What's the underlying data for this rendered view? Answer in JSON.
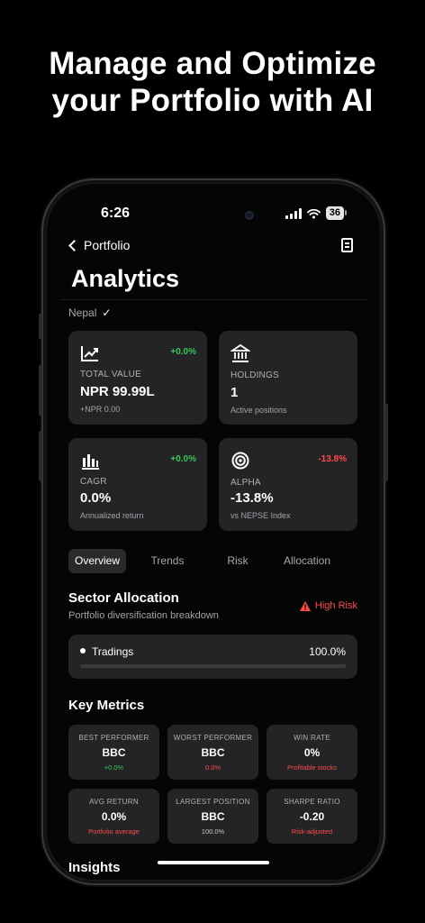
{
  "promo": {
    "line1": "Manage and Optimize",
    "line2": "your Portfolio with AI"
  },
  "status": {
    "time": "6:26",
    "battery": "36"
  },
  "nav": {
    "back_label": "Portfolio"
  },
  "page": {
    "title": "Analytics",
    "region": "Nepal",
    "region_check": "✓"
  },
  "cards": [
    {
      "label": "TOTAL VALUE",
      "value": "NPR 99.99L",
      "sub": "+NPR 0.00",
      "change": "+0.0%",
      "icon": "trend-chart-icon"
    },
    {
      "label": "HOLDINGS",
      "value": "1",
      "sub": "Active positions",
      "change": "",
      "icon": "bank-icon"
    },
    {
      "label": "CAGR",
      "value": "0.0%",
      "sub": "Annualized return",
      "change": "+0.0%",
      "icon": "bar-chart-icon"
    },
    {
      "label": "ALPHA",
      "value": "-13.8%",
      "sub": "vs NEPSE Index",
      "change": "-13.8%",
      "icon": "target-icon"
    }
  ],
  "tabs": [
    "Overview",
    "Trends",
    "Risk",
    "Allocation"
  ],
  "sector": {
    "title": "Sector Allocation",
    "subtitle": "Portfolio diversification breakdown",
    "risk_label": "High Risk",
    "items": [
      {
        "name": "Tradings",
        "percent": "100.0%",
        "fill": 1.0
      }
    ]
  },
  "key_metrics": {
    "title": "Key Metrics",
    "items": [
      {
        "label": "BEST PERFORMER",
        "value": "BBC",
        "sub": "+0.0%"
      },
      {
        "label": "WORST PERFORMER",
        "value": "BBC",
        "sub": "0.0%"
      },
      {
        "label": "WIN RATE",
        "value": "0%",
        "sub": "Profitable stocks"
      },
      {
        "label": "AVG RETURN",
        "value": "0.0%",
        "sub": "Portfolio average"
      },
      {
        "label": "LARGEST POSITION",
        "value": "BBC",
        "sub": "100.0%"
      },
      {
        "label": "SHARPE RATIO",
        "value": "-0.20",
        "sub": "Risk-adjusted"
      }
    ]
  },
  "insights": {
    "title": "Insights"
  },
  "colors": {
    "green": "#34c759",
    "red": "#ff4a4a",
    "card": "#242426",
    "background": "#050505"
  }
}
